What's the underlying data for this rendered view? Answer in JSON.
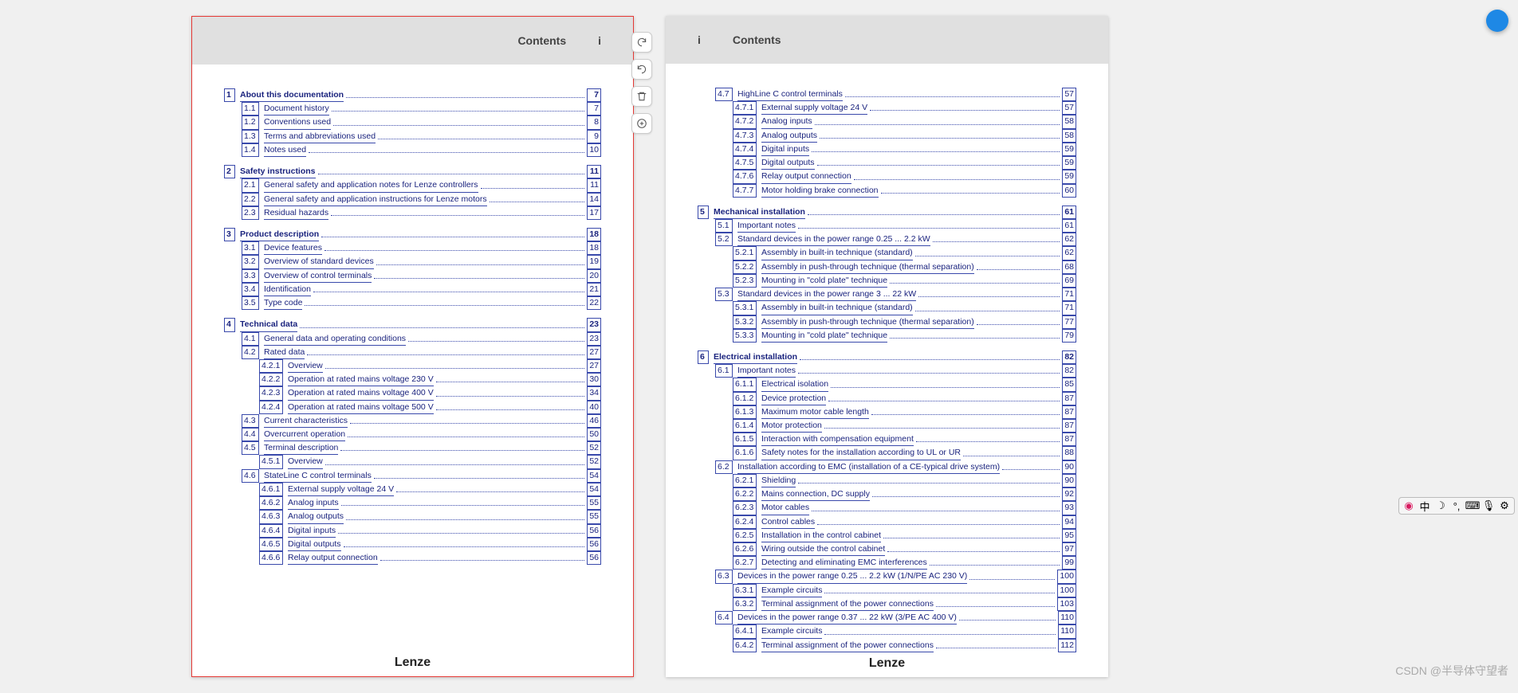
{
  "header": {
    "title": "Contents",
    "marker": "i"
  },
  "footer": {
    "brand": "Lenze"
  },
  "watermark": "CSDN @半导体守望者",
  "ime_bar": {
    "items": [
      "中",
      "ᶧ",
      "ᵒ",
      "⌨",
      "🎤",
      "⚙"
    ]
  },
  "page1": {
    "sections": [
      {
        "rows": [
          {
            "lvl": 1,
            "num": "1",
            "title": "About this documentation",
            "pg": "7"
          },
          {
            "lvl": 2,
            "num": "1.1",
            "title": "Document history",
            "pg": "7"
          },
          {
            "lvl": 2,
            "num": "1.2",
            "title": "Conventions used",
            "pg": "8"
          },
          {
            "lvl": 2,
            "num": "1.3",
            "title": "Terms and abbreviations used",
            "pg": "9"
          },
          {
            "lvl": 2,
            "num": "1.4",
            "title": "Notes used",
            "pg": "10"
          }
        ]
      },
      {
        "rows": [
          {
            "lvl": 1,
            "num": "2",
            "title": "Safety instructions",
            "pg": "11"
          },
          {
            "lvl": 2,
            "num": "2.1",
            "title": "General safety and application notes for Lenze controllers",
            "pg": "11"
          },
          {
            "lvl": 2,
            "num": "2.2",
            "title": "General safety and application instructions for Lenze motors",
            "pg": "14"
          },
          {
            "lvl": 2,
            "num": "2.3",
            "title": "Residual hazards",
            "pg": "17"
          }
        ]
      },
      {
        "rows": [
          {
            "lvl": 1,
            "num": "3",
            "title": "Product description",
            "pg": "18"
          },
          {
            "lvl": 2,
            "num": "3.1",
            "title": "Device features",
            "pg": "18"
          },
          {
            "lvl": 2,
            "num": "3.2",
            "title": "Overview of standard devices",
            "pg": "19"
          },
          {
            "lvl": 2,
            "num": "3.3",
            "title": "Overview of control terminals",
            "pg": "20"
          },
          {
            "lvl": 2,
            "num": "3.4",
            "title": "Identification",
            "pg": "21"
          },
          {
            "lvl": 2,
            "num": "3.5",
            "title": "Type code",
            "pg": "22"
          }
        ]
      },
      {
        "rows": [
          {
            "lvl": 1,
            "num": "4",
            "title": "Technical data",
            "pg": "23"
          },
          {
            "lvl": 2,
            "num": "4.1",
            "title": "General data and operating conditions",
            "pg": "23"
          },
          {
            "lvl": 2,
            "num": "4.2",
            "title": "Rated data",
            "pg": "27"
          },
          {
            "lvl": 3,
            "num": "4.2.1",
            "title": "Overview",
            "pg": "27"
          },
          {
            "lvl": 3,
            "num": "4.2.2",
            "title": "Operation at rated mains voltage 230 V",
            "pg": "30"
          },
          {
            "lvl": 3,
            "num": "4.2.3",
            "title": "Operation at rated mains voltage 400 V",
            "pg": "34"
          },
          {
            "lvl": 3,
            "num": "4.2.4",
            "title": "Operation at rated mains voltage 500 V",
            "pg": "40"
          },
          {
            "lvl": 2,
            "num": "4.3",
            "title": "Current characteristics",
            "pg": "46"
          },
          {
            "lvl": 2,
            "num": "4.4",
            "title": "Overcurrent operation",
            "pg": "50"
          },
          {
            "lvl": 2,
            "num": "4.5",
            "title": "Terminal description",
            "pg": "52"
          },
          {
            "lvl": 3,
            "num": "4.5.1",
            "title": "Overview",
            "pg": "52"
          },
          {
            "lvl": 2,
            "num": "4.6",
            "title": "StateLine C control terminals",
            "pg": "54"
          },
          {
            "lvl": 3,
            "num": "4.6.1",
            "title": "External supply voltage 24 V",
            "pg": "54"
          },
          {
            "lvl": 3,
            "num": "4.6.2",
            "title": "Analog inputs",
            "pg": "55"
          },
          {
            "lvl": 3,
            "num": "4.6.3",
            "title": "Analog outputs",
            "pg": "55"
          },
          {
            "lvl": 3,
            "num": "4.6.4",
            "title": "Digital inputs",
            "pg": "56"
          },
          {
            "lvl": 3,
            "num": "4.6.5",
            "title": "Digital outputs",
            "pg": "56"
          },
          {
            "lvl": 3,
            "num": "4.6.6",
            "title": "Relay output connection",
            "pg": "56"
          }
        ]
      }
    ]
  },
  "page2": {
    "sections": [
      {
        "rows": [
          {
            "lvl": 2,
            "num": "4.7",
            "title": "HighLine C control terminals",
            "pg": "57"
          },
          {
            "lvl": 3,
            "num": "4.7.1",
            "title": "External supply voltage 24 V",
            "pg": "57"
          },
          {
            "lvl": 3,
            "num": "4.7.2",
            "title": "Analog inputs",
            "pg": "58"
          },
          {
            "lvl": 3,
            "num": "4.7.3",
            "title": "Analog outputs",
            "pg": "58"
          },
          {
            "lvl": 3,
            "num": "4.7.4",
            "title": "Digital inputs",
            "pg": "59"
          },
          {
            "lvl": 3,
            "num": "4.7.5",
            "title": "Digital outputs",
            "pg": "59"
          },
          {
            "lvl": 3,
            "num": "4.7.6",
            "title": "Relay output connection",
            "pg": "59"
          },
          {
            "lvl": 3,
            "num": "4.7.7",
            "title": "Motor holding brake connection",
            "pg": "60"
          }
        ]
      },
      {
        "rows": [
          {
            "lvl": 1,
            "num": "5",
            "title": "Mechanical installation",
            "pg": "61"
          },
          {
            "lvl": 2,
            "num": "5.1",
            "title": "Important notes",
            "pg": "61"
          },
          {
            "lvl": 2,
            "num": "5.2",
            "title": "Standard devices in the power range 0.25 ... 2.2 kW",
            "pg": "62"
          },
          {
            "lvl": 3,
            "num": "5.2.1",
            "title": "Assembly in built-in technique (standard)",
            "pg": "62"
          },
          {
            "lvl": 3,
            "num": "5.2.2",
            "title": "Assembly in push-through technique (thermal separation)",
            "pg": "68"
          },
          {
            "lvl": 3,
            "num": "5.2.3",
            "title": "Mounting in \"cold plate\" technique",
            "pg": "69"
          },
          {
            "lvl": 2,
            "num": "5.3",
            "title": "Standard devices in the power range 3 ... 22 kW",
            "pg": "71"
          },
          {
            "lvl": 3,
            "num": "5.3.1",
            "title": "Assembly in built-in technique (standard)",
            "pg": "71"
          },
          {
            "lvl": 3,
            "num": "5.3.2",
            "title": "Assembly in push-through technique (thermal separation)",
            "pg": "77"
          },
          {
            "lvl": 3,
            "num": "5.3.3",
            "title": "Mounting in \"cold plate\" technique",
            "pg": "79"
          }
        ]
      },
      {
        "rows": [
          {
            "lvl": 1,
            "num": "6",
            "title": "Electrical installation",
            "pg": "82"
          },
          {
            "lvl": 2,
            "num": "6.1",
            "title": "Important notes",
            "pg": "82"
          },
          {
            "lvl": 3,
            "num": "6.1.1",
            "title": "Electrical isolation",
            "pg": "85"
          },
          {
            "lvl": 3,
            "num": "6.1.2",
            "title": "Device protection",
            "pg": "87"
          },
          {
            "lvl": 3,
            "num": "6.1.3",
            "title": "Maximum motor cable length",
            "pg": "87"
          },
          {
            "lvl": 3,
            "num": "6.1.4",
            "title": "Motor protection",
            "pg": "87"
          },
          {
            "lvl": 3,
            "num": "6.1.5",
            "title": "Interaction with compensation equipment",
            "pg": "87"
          },
          {
            "lvl": 3,
            "num": "6.1.6",
            "title": "Safety notes for the installation according to UL or UR",
            "pg": "88"
          },
          {
            "lvl": 2,
            "num": "6.2",
            "title": "Installation according to EMC (installation of a CE-typical drive system)",
            "pg": "90"
          },
          {
            "lvl": 3,
            "num": "6.2.1",
            "title": "Shielding",
            "pg": "90"
          },
          {
            "lvl": 3,
            "num": "6.2.2",
            "title": "Mains connection, DC supply",
            "pg": "92"
          },
          {
            "lvl": 3,
            "num": "6.2.3",
            "title": "Motor cables",
            "pg": "93"
          },
          {
            "lvl": 3,
            "num": "6.2.4",
            "title": "Control cables",
            "pg": "94"
          },
          {
            "lvl": 3,
            "num": "6.2.5",
            "title": "Installation in the control cabinet",
            "pg": "95"
          },
          {
            "lvl": 3,
            "num": "6.2.6",
            "title": "Wiring outside the control cabinet",
            "pg": "97"
          },
          {
            "lvl": 3,
            "num": "6.2.7",
            "title": "Detecting and eliminating EMC interferences",
            "pg": "99"
          },
          {
            "lvl": 2,
            "num": "6.3",
            "title": "Devices in the power range 0.25 ... 2.2 kW (1/N/PE AC 230 V)",
            "pg": "100"
          },
          {
            "lvl": 3,
            "num": "6.3.1",
            "title": "Example circuits",
            "pg": "100"
          },
          {
            "lvl": 3,
            "num": "6.3.2",
            "title": "Terminal assignment of the power connections",
            "pg": "103"
          },
          {
            "lvl": 2,
            "num": "6.4",
            "title": "Devices in the power range 0.37 ... 22 kW (3/PE AC 400 V)",
            "pg": "110"
          },
          {
            "lvl": 3,
            "num": "6.4.1",
            "title": "Example circuits",
            "pg": "110"
          },
          {
            "lvl": 3,
            "num": "6.4.2",
            "title": "Terminal assignment of the power connections",
            "pg": "112"
          }
        ]
      }
    ]
  }
}
